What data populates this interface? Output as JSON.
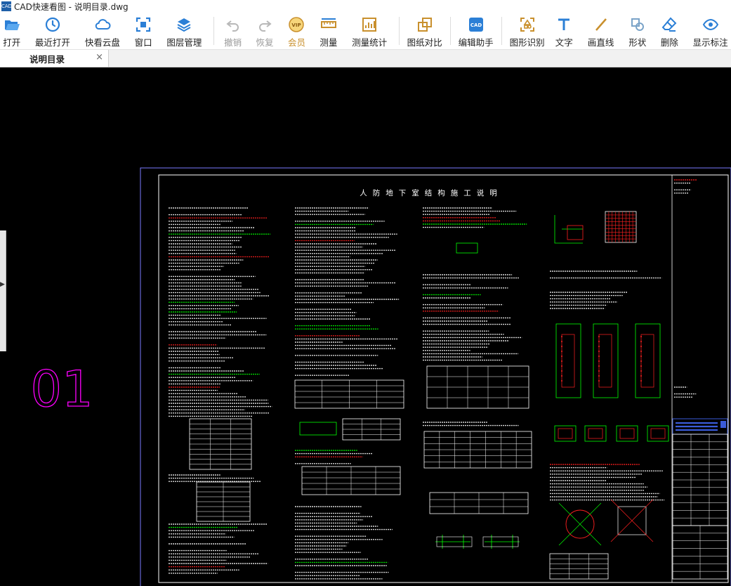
{
  "window": {
    "title": "CAD快速看图 - 说明目录.dwg",
    "app_icon_text": "CAD"
  },
  "toolbar": {
    "items": [
      {
        "label": "打开",
        "icon": "folder-open-icon",
        "enabled": true
      },
      {
        "label": "最近打开",
        "icon": "clock-history-icon",
        "enabled": true
      },
      {
        "label": "快看云盘",
        "icon": "cloud-icon",
        "enabled": true
      },
      {
        "label": "窗口",
        "icon": "window-frame-icon",
        "enabled": true
      },
      {
        "label": "图层管理",
        "icon": "layers-icon",
        "enabled": true
      },
      {
        "label": "撤销",
        "icon": "undo-icon",
        "enabled": false
      },
      {
        "label": "恢复",
        "icon": "redo-icon",
        "enabled": false
      },
      {
        "label": "会员",
        "icon": "vip-badge-icon",
        "enabled": true
      },
      {
        "label": "测量",
        "icon": "ruler-icon",
        "enabled": true
      },
      {
        "label": "测量统计",
        "icon": "measure-stats-icon",
        "enabled": true
      },
      {
        "label": "图纸对比",
        "icon": "compare-icon",
        "enabled": true
      },
      {
        "label": "编辑助手",
        "icon": "edit-assistant-icon",
        "enabled": true
      },
      {
        "label": "图形识别",
        "icon": "shape-recognize-icon",
        "enabled": true
      },
      {
        "label": "文字",
        "icon": "text-t-icon",
        "enabled": true
      },
      {
        "label": "画直线",
        "icon": "line-draw-icon",
        "enabled": true
      },
      {
        "label": "形状",
        "icon": "shapes-icon",
        "enabled": true
      },
      {
        "label": "删除",
        "icon": "eraser-icon",
        "enabled": true
      },
      {
        "label": "显示标注",
        "icon": "eye-icon",
        "enabled": true
      }
    ],
    "vip_badge_text": "VIP",
    "edit_badge_text": "CAD"
  },
  "tabs": [
    {
      "label": "说明目录",
      "active": true
    }
  ],
  "tab_close": "×",
  "drawing": {
    "sheet_label": "01",
    "main_title": "人防地下室结构施工说明",
    "colors": {
      "background": "#000000",
      "outer_frame": "#7a7aff",
      "inner_frame": "#ffffff",
      "text": "#ffffff",
      "heading": "#00ff00",
      "highlight": "#ff2020",
      "sheet_label": "#ff00ff",
      "accent_blue": "#3a5bd9"
    }
  },
  "icons": {
    "side_arrow": "▶"
  }
}
